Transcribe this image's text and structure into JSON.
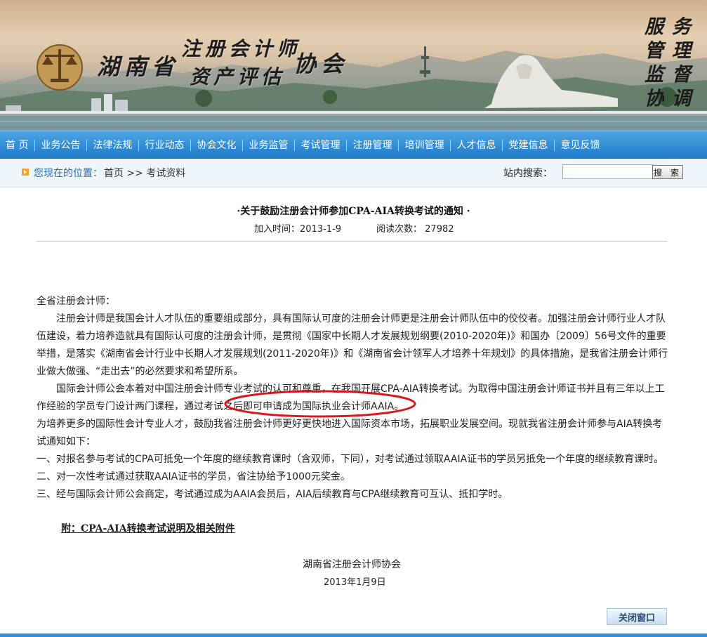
{
  "banner": {
    "province": "湖南省",
    "title_line1": "注册会计师",
    "title_line2": "资产评估",
    "association": "协会",
    "motto": [
      "服务",
      "管理",
      "监督",
      "协调"
    ]
  },
  "nav": {
    "items": [
      "首 页",
      "业务公告",
      "法律法规",
      "行业动态",
      "协会文化",
      "业务监管",
      "考试管理",
      "注册管理",
      "培训管理",
      "人才信息",
      "党建信息",
      "意见反馈"
    ]
  },
  "location": {
    "label": "您现在的位置：",
    "path": "首页 >> 考试资料"
  },
  "search": {
    "label": "站内搜索：",
    "value": "",
    "button": "搜 索"
  },
  "article": {
    "title": "·关于鼓励注册会计师参加CPA-AIA转换考试的通知 ·",
    "added_label": "加入时间：2013-1-9",
    "reads_label": "阅读次数： 27982",
    "salutation": "全省注册会计师：",
    "paragraph1": "注册会计师是我国会计人才队伍的重要组成部分，具有国际认可度的注册会计师更是注册会计师队伍中的佼佼者。加强注册会计师行业人才队伍建设，着力培养造就具有国际认可度的注册会计师，是贯彻《国家中长期人才发展规划纲要(2010-2020年)》和国办〔2009〕56号文件的重要举措，是落实《湖南省会计行业中长期人才发展规划(2011-2020年)》和《湖南省会计领军人才培养十年规划》的具体措施，是我省注册会计师行业做大做强、“走出去”的必然要求和希望所系。",
    "paragraph2": "国际会计师公会本着对中国注册会计师专业考试的认可和尊重，在我国开展CPA-AIA转换考试。为取得中国注册会计师证书并且有三年以上工作经验的学员专门设计两门课程，通过考试之后即可申请成为国际执业会计师AAIA。",
    "paragraph3": "为培养更多的国际性会计专业人才，鼓励我省注册会计师更好更快地进入国际资本市场，拓展职业发展空间。现就我省注册会计师参与AIA转换考试通知如下：",
    "item1": "一、对报名参与考试的CPA可抵免一个年度的继续教育课时（含双师，下同），对考试通过领取AAIA证书的学员另抵免一个年度的继续教育课时。",
    "item2": "二、对一次性考试通过获取AAIA证书的学员，省注协给予1000元奖金。",
    "item3": "三、经与国际会计师公会商定，考试通过成为AAIA会员后，AIA后续教育与CPA继续教育可互认、抵扣学时。",
    "attachment": "附：CPA-AIA转换考试说明及相关附件",
    "signature_org": "湖南省注册会计师协会",
    "signature_date": "2013年1月9日"
  },
  "close_button": "关闭窗口",
  "colors": {
    "nav_top": "#4ea5e2",
    "nav_bottom": "#1b78c8",
    "location_text": "#2a6cb3",
    "highlight_ellipse": "#d8181e"
  }
}
